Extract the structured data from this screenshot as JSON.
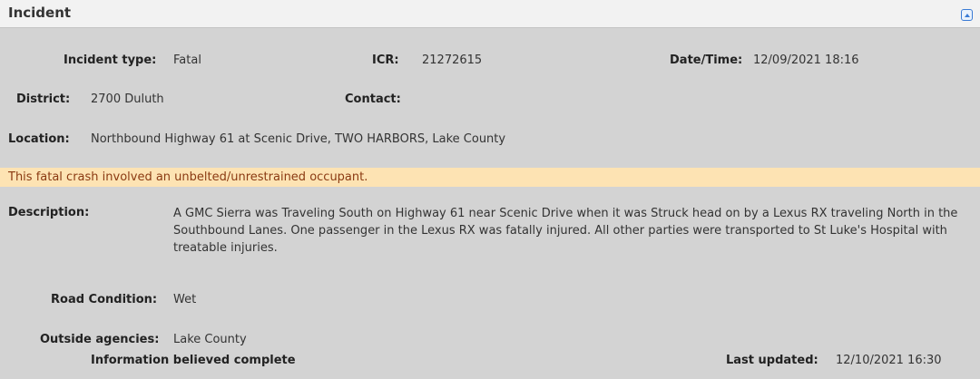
{
  "panel": {
    "title": "Incident",
    "collapse_icon": "chevron-up-icon"
  },
  "incident_type": {
    "label": "Incident type:",
    "value": "Fatal"
  },
  "icr": {
    "label": "ICR:",
    "value": "21272615"
  },
  "datetime": {
    "label": "Date/Time:",
    "value": "12/09/2021 18:16"
  },
  "district": {
    "label": "District:",
    "value": "2700 Duluth"
  },
  "contact": {
    "label": "Contact:",
    "value": ""
  },
  "location": {
    "label": "Location:",
    "value": "Northbound Highway 61 at Scenic Drive, TWO HARBORS, Lake County"
  },
  "alert": {
    "text": "This fatal crash involved an unbelted/unrestrained occupant."
  },
  "description": {
    "label": "Description:",
    "value": "A GMC Sierra was Traveling South on Highway 61 near Scenic Drive when it was Struck head on by a Lexus RX traveling North in the Southbound Lanes. One passenger in the Lexus RX was fatally injured. All other parties were transported to St Luke's Hospital with treatable injuries."
  },
  "road_condition": {
    "label": "Road Condition:",
    "value": "Wet"
  },
  "outside_agencies": {
    "label": "Outside agencies:",
    "value": "Lake County"
  },
  "info_status": {
    "text": "Information believed complete"
  },
  "last_updated": {
    "label": "Last updated:",
    "value": "12/10/2021 16:30"
  },
  "colors": {
    "background": "#d3d3d3",
    "header": "#f2f2f2",
    "alert_background": "#fde3b3",
    "alert_text": "#8a3a12",
    "accent": "#3a7bd5"
  }
}
